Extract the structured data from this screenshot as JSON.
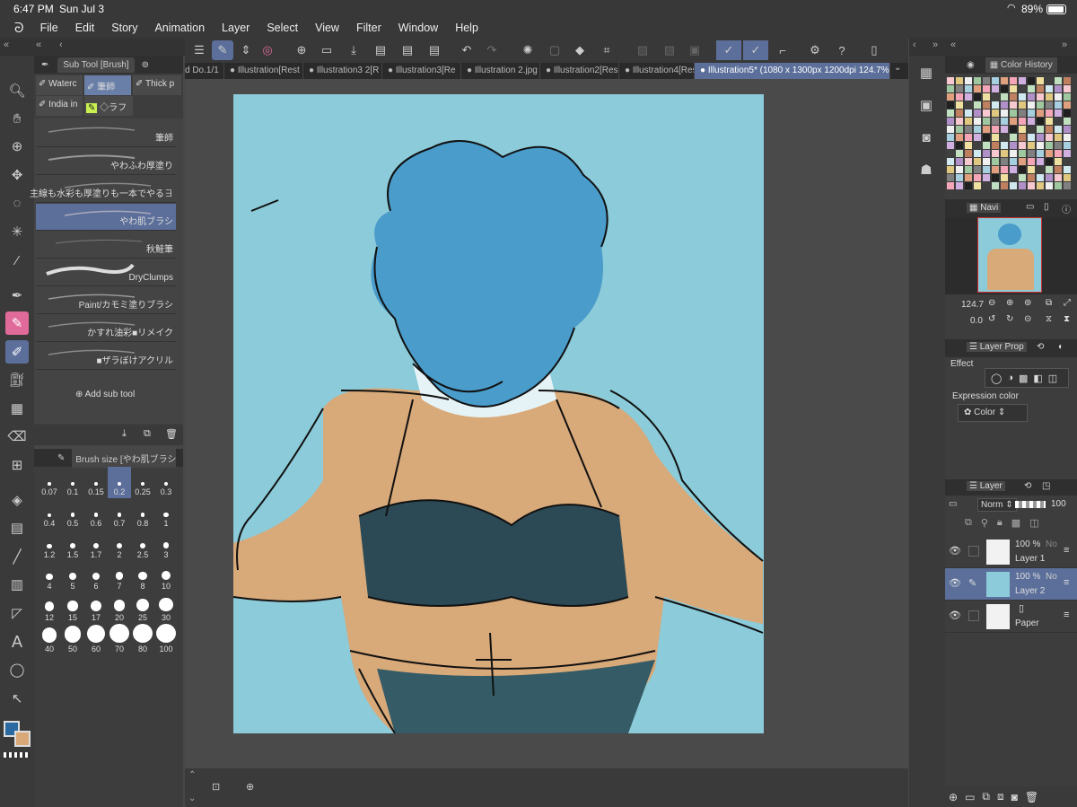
{
  "status": {
    "time": "6:47 PM",
    "date": "Sun Jul 3",
    "battery": "89%"
  },
  "menu": [
    "File",
    "Edit",
    "Story",
    "Animation",
    "Layer",
    "Select",
    "View",
    "Filter",
    "Window",
    "Help"
  ],
  "subtool": {
    "title": "Sub Tool [Brush]",
    "tabs": [
      "Waterc",
      "筆師",
      "Thick p",
      "India in",
      "◇ラフ"
    ],
    "brushes": [
      "筆師",
      "やわふわ厚塗り",
      "主線も水彩も厚塗りも一本でやる∃",
      "やわ肌ブラシ",
      "秋鮭筆",
      "DryClumps",
      "Paint/カモミ塗りブラシ",
      "かすれ油彩■リメイク",
      "■ザラぼけアクリル"
    ],
    "add": "Add sub tool"
  },
  "brushsize": {
    "title": "Brush size [やわ肌ブラシ",
    "sizes": [
      "0.07",
      "0.1",
      "0.15",
      "0.2",
      "0.25",
      "0.3",
      "0.4",
      "0.5",
      "0.6",
      "0.7",
      "0.8",
      "1",
      "1.2",
      "1.5",
      "1.7",
      "2",
      "2.5",
      "3",
      "4",
      "5",
      "6",
      "7",
      "8",
      "10",
      "12",
      "15",
      "17",
      "20",
      "25",
      "30",
      "40",
      "50",
      "60",
      "70",
      "80",
      "100"
    ]
  },
  "tabs": [
    "d Do.1/1",
    "Illustration[Rest",
    "Illustration3 2[R",
    "Illustration3[Re",
    "Illustration 2.jpg",
    "Illustration2[Res",
    "Illustration4[Res",
    "Illustration5* (1080 x 1300px 1200dpi 124.7%)"
  ],
  "colorHistory": {
    "title": "Color History"
  },
  "navigator": {
    "title": "Navi",
    "zoom": "124.7",
    "rotate": "0.0"
  },
  "layerProp": {
    "title": "Layer Prop",
    "effect": "Effect",
    "expression": "Expression color",
    "color": "Color"
  },
  "layers": {
    "title": "Layer",
    "blend": "Norm",
    "opacity": "100",
    "items": [
      {
        "pct": "100 %",
        "mode": "No",
        "name": "Layer 1"
      },
      {
        "pct": "100 %",
        "mode": "No",
        "name": "Layer 2"
      },
      {
        "pct": "",
        "mode": "",
        "name": "Paper"
      }
    ]
  },
  "colors": {
    "canvasBg": "#8cc8d8",
    "hair": "#4a9ac8",
    "skin": "#d9a878",
    "accent": "#5b6f9a"
  }
}
